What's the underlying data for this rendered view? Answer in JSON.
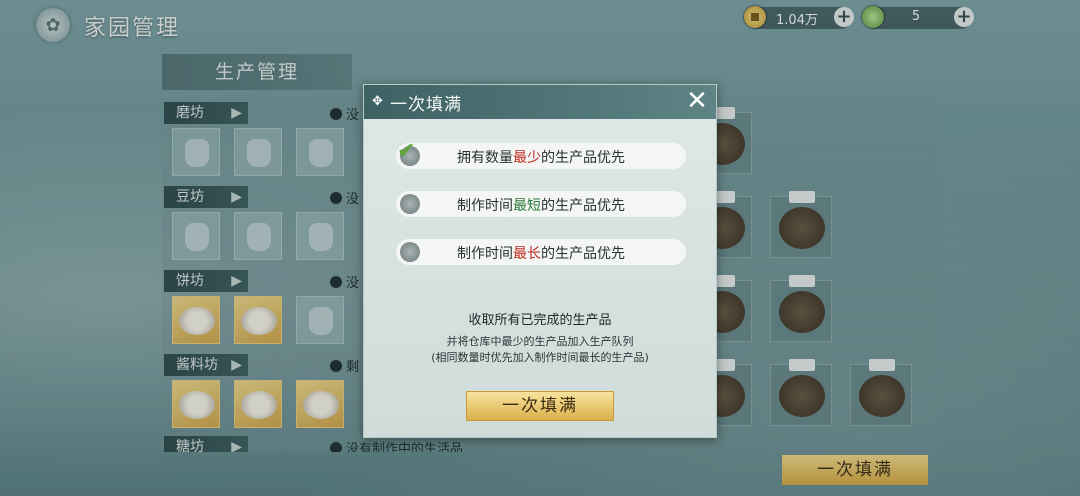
{
  "header": {
    "title": "家园管理"
  },
  "currency": {
    "coins": "1.04万",
    "jade": "5"
  },
  "panel": {
    "title": "生产管理"
  },
  "rows": [
    {
      "name": "磨坊",
      "status": "没"
    },
    {
      "name": "豆坊",
      "status": "没"
    },
    {
      "name": "饼坊",
      "status": "没"
    },
    {
      "name": "酱料坊",
      "status": "剩"
    },
    {
      "name": "糖坊",
      "status": "没有制作中的生活品"
    }
  ],
  "bottom_button": "一次填满",
  "modal": {
    "title": "一次填满",
    "options": [
      {
        "pre": "拥有数量",
        "hl": "最少",
        "post": "的生产品优先",
        "checked": true
      },
      {
        "pre": "制作时间",
        "hl": "最短",
        "post": "的生产品优先",
        "checked": false
      },
      {
        "pre": "制作时间",
        "hl": "最长",
        "post": "的生产品优先",
        "checked": false
      }
    ],
    "desc1": "收取所有已完成的生产品",
    "desc2": "并将仓库中最少的生产品加入生产队列",
    "desc3": "(相同数量时优先加入制作时间最长的生产品)",
    "confirm": "一次填满"
  }
}
